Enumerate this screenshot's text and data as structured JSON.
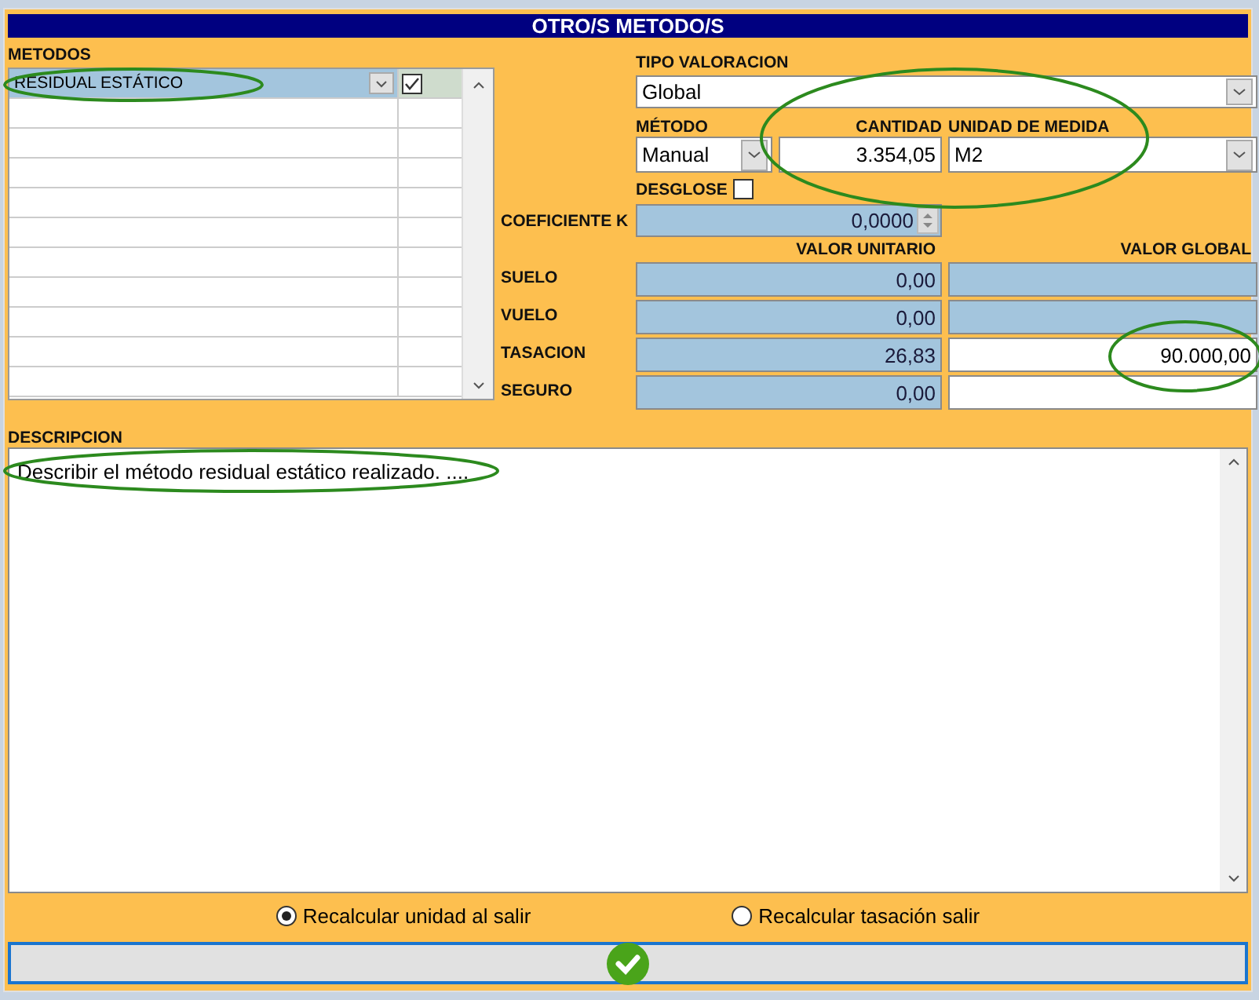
{
  "window": {
    "title": "OTRO/S METODO/S"
  },
  "metodos": {
    "label": "METODOS",
    "rows": [
      {
        "name": "RESIDUAL ESTÁTICO",
        "checked": true,
        "selected": true
      }
    ]
  },
  "tipo_valoracion": {
    "label": "TIPO VALORACION",
    "value": "Global"
  },
  "metodo": {
    "label": "MÉTODO",
    "value": "Manual"
  },
  "cantidad": {
    "label": "CANTIDAD",
    "value": "3.354,05"
  },
  "unidad": {
    "label": "UNIDAD DE MEDIDA",
    "value": "M2"
  },
  "desglose": {
    "label": "DESGLOSE",
    "checked": false
  },
  "coeficiente_k": {
    "label": "COEFICIENTE K",
    "value": "0,0000"
  },
  "valores": {
    "columns": [
      "VALOR UNITARIO",
      "VALOR GLOBAL"
    ],
    "rows": [
      {
        "label": "SUELO",
        "unitario": "0,00",
        "global_disabled": true
      },
      {
        "label": "VUELO",
        "unitario": "0,00",
        "global_disabled": true
      },
      {
        "label": "TASACION",
        "unitario": "26,83",
        "global": "90.000,00",
        "global_disabled": false
      },
      {
        "label": "SEGURO",
        "unitario": "0,00",
        "global_disabled": false
      }
    ]
  },
  "descripcion": {
    "label": "DESCRIPCION",
    "value": "Describir el método residual estático realizado. ...."
  },
  "recalcular": [
    {
      "label": "Recalcular unidad al salir",
      "selected": true
    },
    {
      "label": "Recalcular tasación salir",
      "selected": false
    }
  ]
}
